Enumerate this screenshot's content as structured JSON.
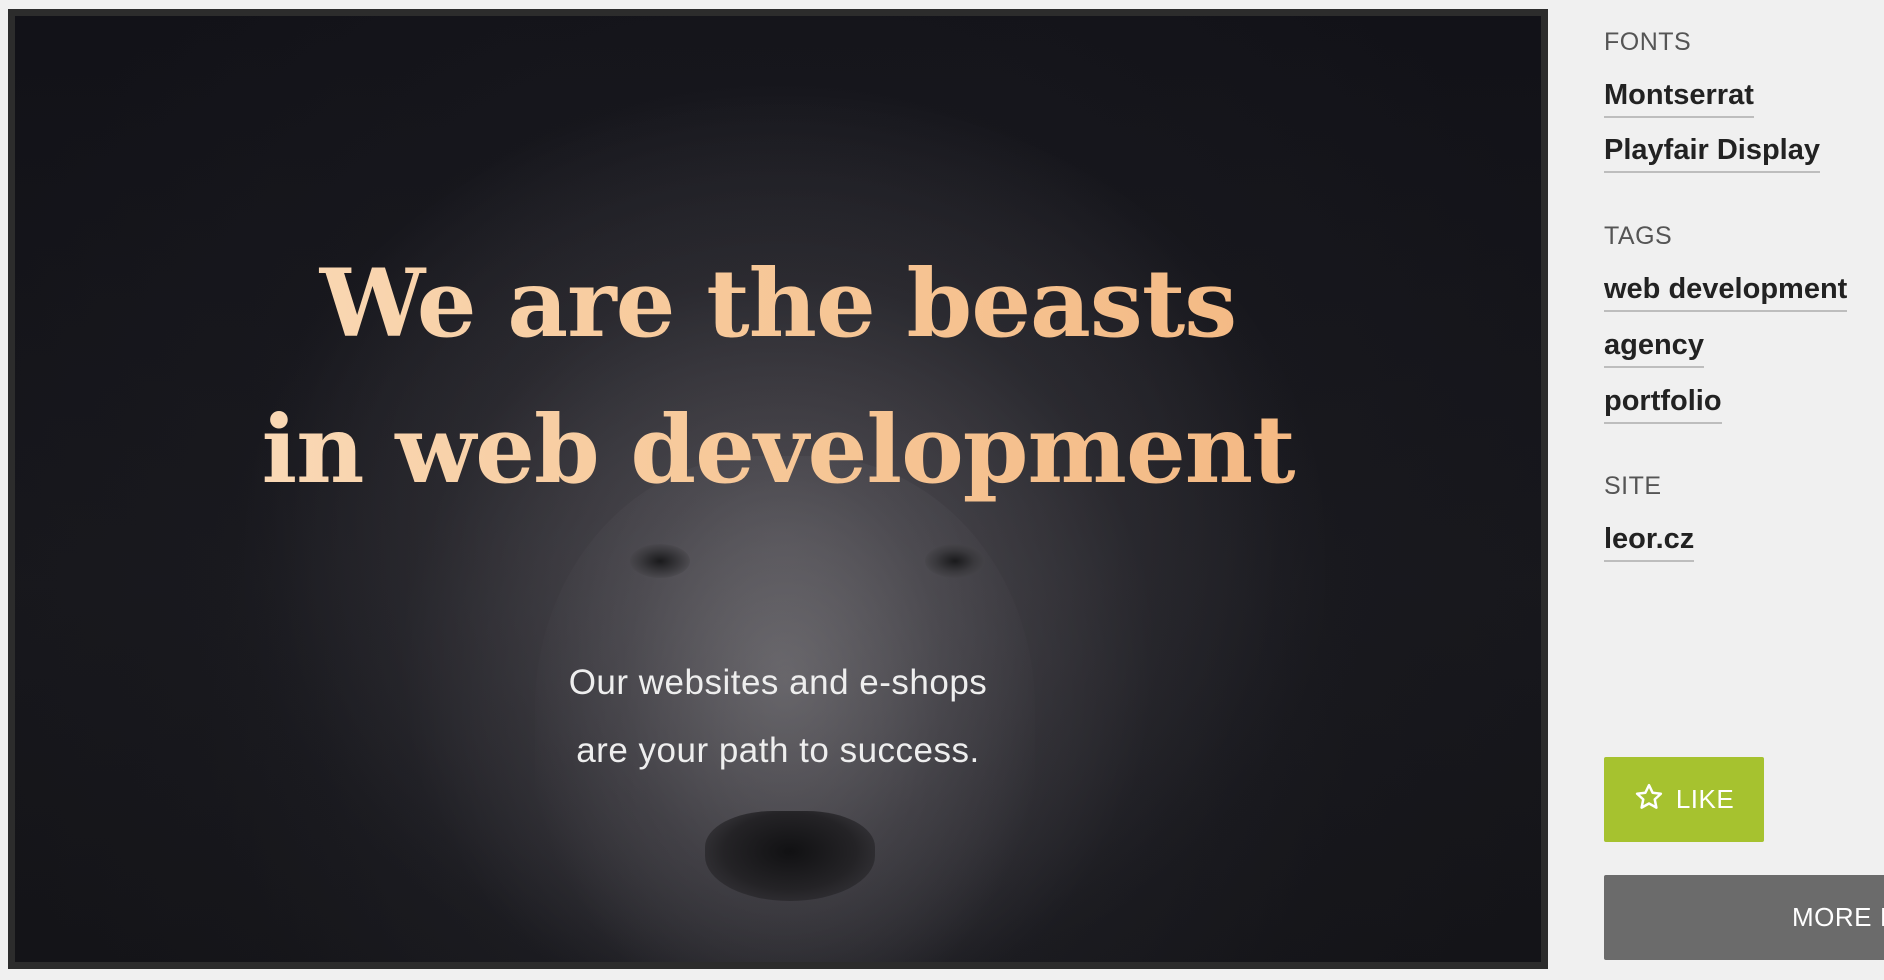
{
  "preview": {
    "headline_line1": "We are the beasts",
    "headline_line2": "in web development",
    "subtext_line1": "Our websites and e-shops",
    "subtext_line2": "are your path to success."
  },
  "sidebar": {
    "fonts_label": "FONTS",
    "fonts": [
      "Montserrat",
      "Playfair Display"
    ],
    "tags_label": "TAGS",
    "tags": [
      "web development",
      "agency",
      "portfolio"
    ],
    "site_label": "SITE",
    "site": "leor.cz"
  },
  "actions": {
    "like_label": "LIKE",
    "like_icon": "star-outline-icon",
    "more_label": "MORE IN"
  },
  "colors": {
    "headline": "#f6c595",
    "like_button": "#a6c22f",
    "more_button": "#6b6b6b",
    "page_background": "#f0f0f0"
  }
}
